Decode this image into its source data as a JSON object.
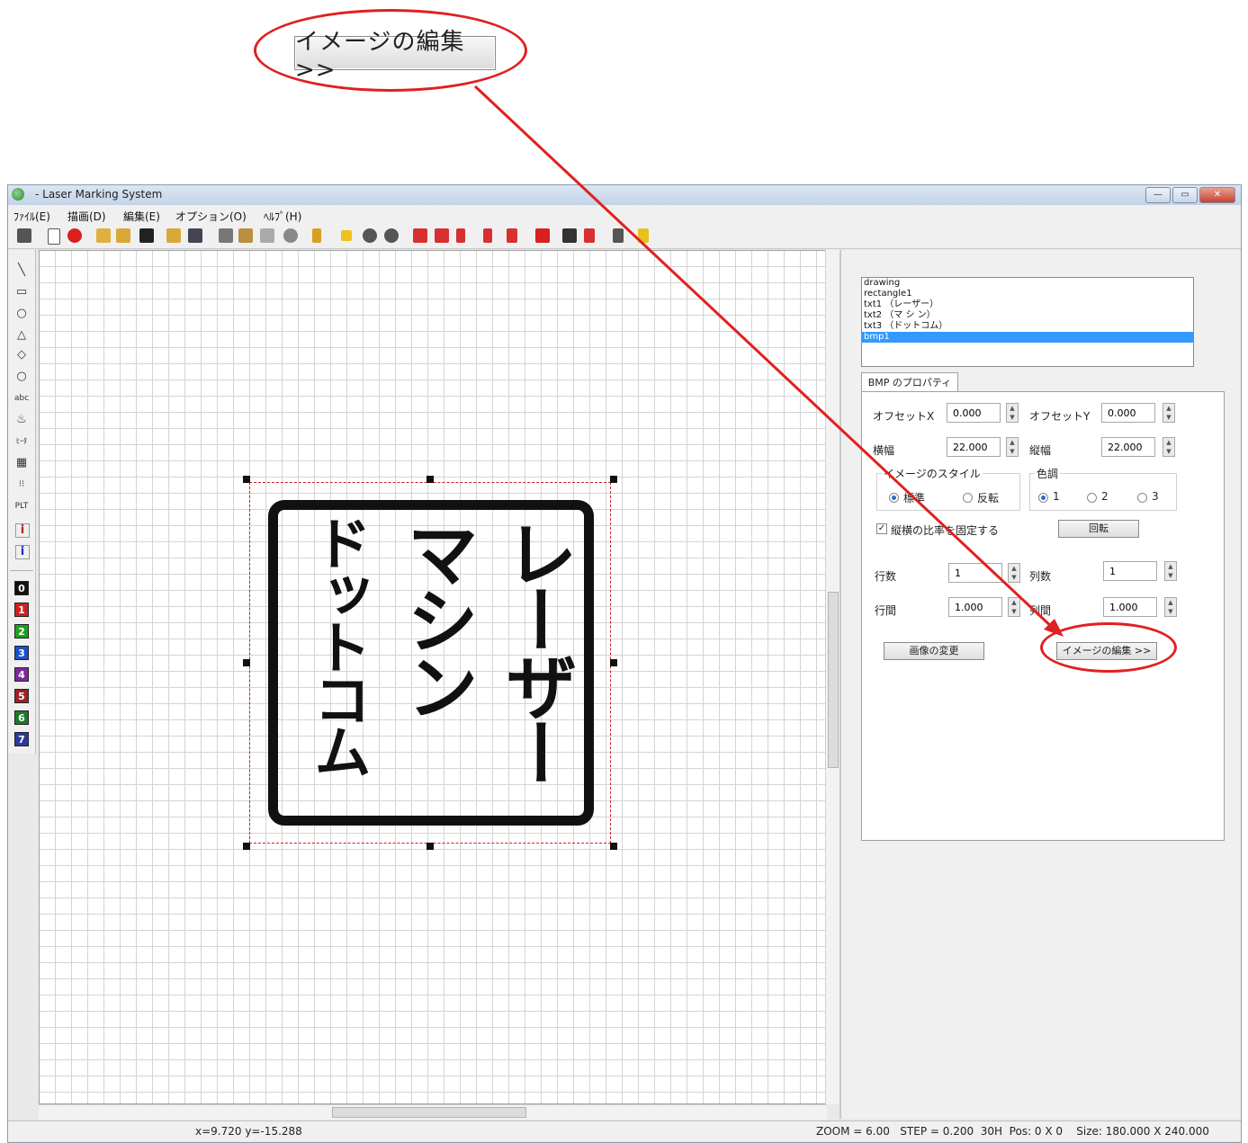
{
  "callout": {
    "label": "イメージの編集 >>"
  },
  "window": {
    "title": "- Laser Marking System",
    "controls": {
      "minimize": "—",
      "maximize": "▭",
      "close": "✕"
    }
  },
  "menu": [
    "ﾌｧｲﾙ(E)",
    "描画(D)",
    "編集(E)",
    "オプション(O)",
    "ﾍﾙﾌﾟ(H)"
  ],
  "palette": {
    "tools": [
      "╲",
      "▭",
      "○",
      "△",
      "◇",
      "○",
      "abc",
      "♨",
      "ﾋｰﾀ",
      "▦",
      "⁝⁝",
      "PLT",
      "i",
      "i"
    ],
    "colors": [
      {
        "label": "0",
        "color": "#111111"
      },
      {
        "label": "1",
        "color": "#cc2020"
      },
      {
        "label": "2",
        "color": "#1fa01f"
      },
      {
        "label": "3",
        "color": "#1c4fc8"
      },
      {
        "label": "4",
        "color": "#7a2a9a"
      },
      {
        "label": "5",
        "color": "#9a2424"
      },
      {
        "label": "6",
        "color": "#1a7a2a"
      },
      {
        "label": "7",
        "color": "#2a3a9a"
      }
    ]
  },
  "stamp": {
    "col_right": "レーザー",
    "col_mid": "マシン",
    "col_left": "ドットコム"
  },
  "status": {
    "coords": "x=9.720 y=-15.288",
    "info": "ZOOM = 6.00   STEP = 0.200  30H  Pos: 0 X 0    Size: 180.000 X 240.000"
  },
  "objects": {
    "items": [
      "drawing",
      "rectangle1",
      "txt1 （レーザー）",
      "txt2 （マ シ ン）",
      "txt3 （ドットコム）",
      "bmp1"
    ],
    "selected_index": 5
  },
  "properties": {
    "tab": "BMP のプロパティ",
    "offset_x": {
      "label": "オフセットX",
      "value": "0.000"
    },
    "offset_y": {
      "label": "オフセットY",
      "value": "0.000"
    },
    "width": {
      "label": "横幅",
      "value": "22.000"
    },
    "height": {
      "label": "縦幅",
      "value": "22.000"
    },
    "image_style": {
      "label": "イメージのスタイル",
      "opt1": "標準",
      "opt2": "反転"
    },
    "tone": {
      "label": "色調",
      "opt1": "1",
      "opt2": "2",
      "opt3": "3"
    },
    "keep_ratio": {
      "label": "縦横の比率を固定する"
    },
    "rotate_btn": "回転",
    "rows": {
      "label": "行数",
      "value": "1"
    },
    "cols": {
      "label": "列数",
      "value": "1"
    },
    "row_gap": {
      "label": "行間",
      "value": "1.000"
    },
    "col_gap": {
      "label": "列間",
      "value": "1.000"
    },
    "change_image_btn": "画像の変更",
    "edit_image_btn": "イメージの編集 >>"
  }
}
